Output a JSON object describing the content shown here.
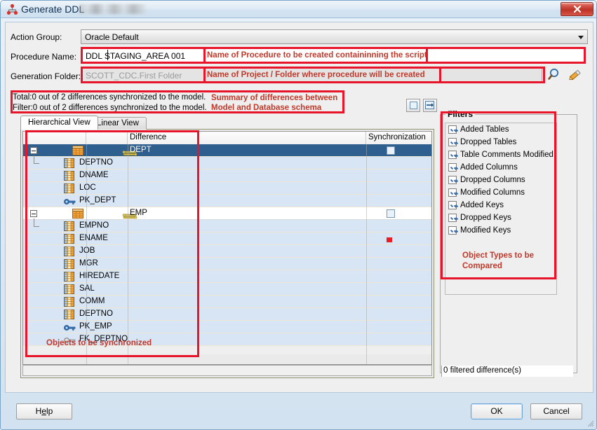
{
  "window": {
    "title": "Generate DDL",
    "title_icon": "hierarchy-icon",
    "close_label": "x"
  },
  "form": {
    "action_group_label": "Action Group:",
    "action_group_value": "Oracle Default",
    "procedure_name_label": "Procedure Name:",
    "procedure_name_value": "DDL STAGING_AREA 001",
    "generation_folder_label": "Generation Folder:",
    "generation_folder_value": "SCOTT_CDC.First Folder",
    "browse_icon": "magnifier-icon",
    "edit_icon": "pencil-icon"
  },
  "summary": {
    "total_line": "Total:0 out of 2 differences synchronized to the model.",
    "filter_line": "Filter:0 out of 2 differences synchronized to the model."
  },
  "tabs": [
    {
      "label": "Hierarchical View",
      "active": true
    },
    {
      "label": "Linear View",
      "active": false
    }
  ],
  "tree": {
    "columns": [
      "",
      "",
      "Difference",
      "Synchronization"
    ],
    "rows": [
      {
        "name": "DEPT",
        "indent": 0,
        "icon": "table-icon",
        "expander": true,
        "diff": true,
        "sync": "checkbox",
        "selected": true,
        "shade": "sel"
      },
      {
        "name": "DEPTNO",
        "indent": 1,
        "icon": "column-icon",
        "expander": false,
        "diff": false,
        "sync": "none",
        "selected": false,
        "shade": "blue",
        "elbow": true
      },
      {
        "name": "DNAME",
        "indent": 1,
        "icon": "column-icon",
        "expander": false,
        "diff": false,
        "sync": "none",
        "selected": false,
        "shade": "blue"
      },
      {
        "name": "LOC",
        "indent": 1,
        "icon": "column-icon",
        "expander": false,
        "diff": false,
        "sync": "none",
        "selected": false,
        "shade": "blue"
      },
      {
        "name": "PK_DEPT",
        "indent": 1,
        "icon": "primary-key-icon",
        "expander": false,
        "diff": false,
        "sync": "none",
        "selected": false,
        "shade": "blue"
      },
      {
        "name": "EMP",
        "indent": 0,
        "icon": "table-icon",
        "expander": true,
        "diff": true,
        "sync": "checkbox",
        "selected": false,
        "shade": "white"
      },
      {
        "name": "EMPNO",
        "indent": 1,
        "icon": "column-icon",
        "expander": false,
        "diff": false,
        "sync": "none",
        "selected": false,
        "shade": "blue",
        "elbow": true
      },
      {
        "name": "ENAME",
        "indent": 1,
        "icon": "column-icon",
        "expander": false,
        "diff": false,
        "sync": "redmark",
        "selected": false,
        "shade": "blue"
      },
      {
        "name": "JOB",
        "indent": 1,
        "icon": "column-icon",
        "expander": false,
        "diff": false,
        "sync": "none",
        "selected": false,
        "shade": "blue"
      },
      {
        "name": "MGR",
        "indent": 1,
        "icon": "column-icon",
        "expander": false,
        "diff": false,
        "sync": "none",
        "selected": false,
        "shade": "blue"
      },
      {
        "name": "HIREDATE",
        "indent": 1,
        "icon": "column-icon",
        "expander": false,
        "diff": false,
        "sync": "none",
        "selected": false,
        "shade": "blue"
      },
      {
        "name": "SAL",
        "indent": 1,
        "icon": "column-icon",
        "expander": false,
        "diff": false,
        "sync": "none",
        "selected": false,
        "shade": "blue"
      },
      {
        "name": "COMM",
        "indent": 1,
        "icon": "column-icon",
        "expander": false,
        "diff": false,
        "sync": "none",
        "selected": false,
        "shade": "blue"
      },
      {
        "name": "DEPTNO",
        "indent": 1,
        "icon": "column-icon",
        "expander": false,
        "diff": false,
        "sync": "none",
        "selected": false,
        "shade": "blue"
      },
      {
        "name": "PK_EMP",
        "indent": 1,
        "icon": "primary-key-icon",
        "expander": false,
        "diff": false,
        "sync": "none",
        "selected": false,
        "shade": "blue"
      },
      {
        "name": "FK_DEPTNO",
        "indent": 1,
        "icon": "foreign-key-icon",
        "expander": false,
        "diff": false,
        "sync": "none",
        "selected": false,
        "shade": "blue"
      }
    ]
  },
  "filters": {
    "legend": "Filters",
    "items": [
      {
        "label": "Added Tables",
        "checked": true
      },
      {
        "label": "Dropped Tables",
        "checked": true
      },
      {
        "label": "Table Comments Modified",
        "checked": true
      },
      {
        "label": "Added Columns",
        "checked": true
      },
      {
        "label": "Dropped Columns",
        "checked": true
      },
      {
        "label": "Modified Columns",
        "checked": true
      },
      {
        "label": "Added Keys",
        "checked": true
      },
      {
        "label": "Dropped Keys",
        "checked": true
      },
      {
        "label": "Modified Keys",
        "checked": true
      }
    ],
    "note_line_1": "Object Types to be",
    "note_line_2": "Compared",
    "filtered_count": "0 filtered difference(s)"
  },
  "buttons": {
    "help": "Help",
    "ok": "OK",
    "cancel": "Cancel"
  },
  "annotations": {
    "procedure_note": "Name of Procedure to be created containinning the script",
    "folder_note": "Name of Project / Folder where procedure will be created",
    "summary_note_1": "Summary of differences between",
    "summary_note_2": "Model and Database schema",
    "tree_note": "Objects to be synchronized",
    "color": "#e8142a",
    "text_color": "#c0392b"
  }
}
